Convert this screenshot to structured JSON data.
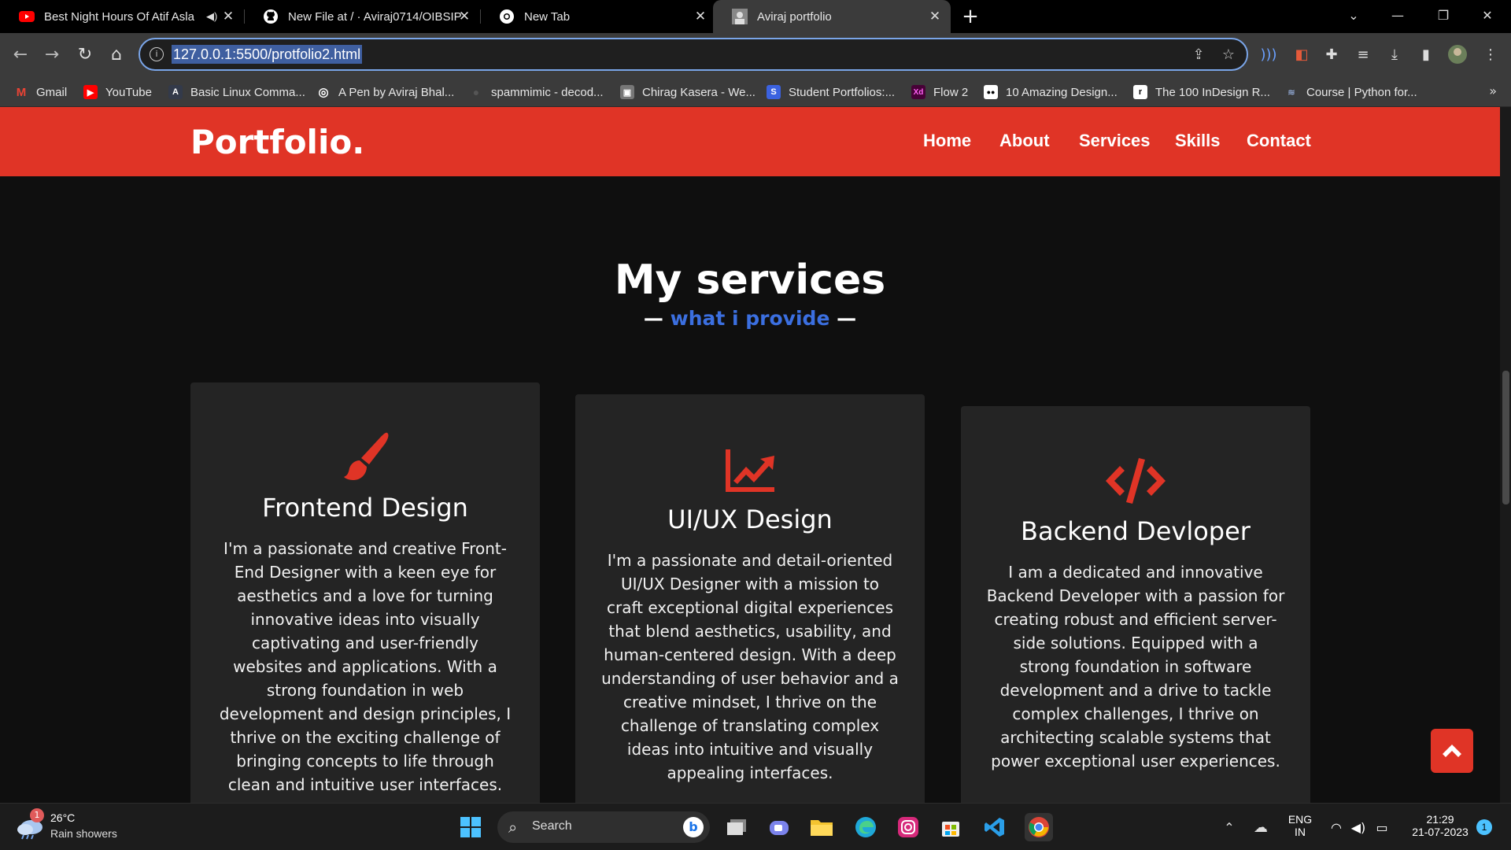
{
  "browser": {
    "tabs": [
      {
        "title": "Best Night Hours Of Atif Asla",
        "icon": "youtube-icon"
      },
      {
        "title": "New File at / · Aviraj0714/OIBSIP",
        "icon": "github-icon"
      },
      {
        "title": "New Tab",
        "icon": "chrome-icon"
      },
      {
        "title": "Aviraj portfolio",
        "icon": "page-favicon"
      }
    ],
    "url": "127.0.0.1:5500/protfolio2.html",
    "bookmarks": [
      {
        "label": "Gmail",
        "color": "#ea4335",
        "glyph": "M"
      },
      {
        "label": "YouTube",
        "color": "#ff0000",
        "glyph": "▶"
      },
      {
        "label": "Basic Linux Comma...",
        "color": "#333a4a",
        "glyph": "A"
      },
      {
        "label": "A Pen by Aviraj Bhal...",
        "color": "#444444",
        "glyph": "◎"
      },
      {
        "label": "spammimic - decod...",
        "color": "#222222",
        "glyph": "●"
      },
      {
        "label": "Chirag Kasera - We...",
        "color": "#666666",
        "glyph": "▣"
      },
      {
        "label": "Student Portfolios:...",
        "color": "#3b62e0",
        "glyph": "S"
      },
      {
        "label": "Flow 2",
        "color": "#470137",
        "glyph": "Xd"
      },
      {
        "label": "10 Amazing Design...",
        "color": "#000000",
        "glyph": "●●"
      },
      {
        "label": "The 100 InDesign R...",
        "color": "#ffffff",
        "glyph": "r"
      },
      {
        "label": "Course | Python for...",
        "color": "#3b3b3b",
        "glyph": "≋"
      }
    ],
    "bookmarks_more": "»"
  },
  "site": {
    "logo": "Portfolio.",
    "nav": [
      "Home",
      "About",
      "Services",
      "Skills",
      "Contact"
    ],
    "section_title": "My services",
    "section_dash_left": "—",
    "section_subtitle": "what i provide",
    "section_dash_right": "—",
    "cards": [
      {
        "icon": "paintbrush-icon",
        "title": "Frontend Design",
        "text": "I'm a passionate and creative Front-End Designer with a keen eye for aesthetics and a love for turning innovative ideas into visually captivating and user-friendly websites and applications. With a strong foundation in web development and design principles, I thrive on the exciting challenge of bringing concepts to life through clean and intuitive user interfaces."
      },
      {
        "icon": "chart-line-icon",
        "title": "UI/UX Design",
        "text": "I'm a passionate and detail-oriented UI/UX Designer with a mission to craft exceptional digital experiences that blend aesthetics, usability, and human-centered design. With a deep understanding of user behavior and a creative mindset, I thrive on the challenge of translating complex ideas into intuitive and visually appealing interfaces."
      },
      {
        "icon": "code-icon",
        "title": "Backend Devloper",
        "text": "I am a dedicated and innovative Backend Developer with a passion for creating robust and efficient server-side solutions. Equipped with a strong foundation in software development and a drive to tackle complex challenges, I thrive on architecting scalable systems that power exceptional user experiences."
      }
    ],
    "accent_color": "#e03426",
    "subtitle_color": "#3b6fe0"
  },
  "taskbar": {
    "weather_temp": "26°C",
    "weather_condition": "Rain showers",
    "weather_badge": "1",
    "search_label": "Search",
    "lang_line1": "ENG",
    "lang_line2": "IN",
    "time": "21:29",
    "date": "21-07-2023",
    "notification_count": "1"
  }
}
